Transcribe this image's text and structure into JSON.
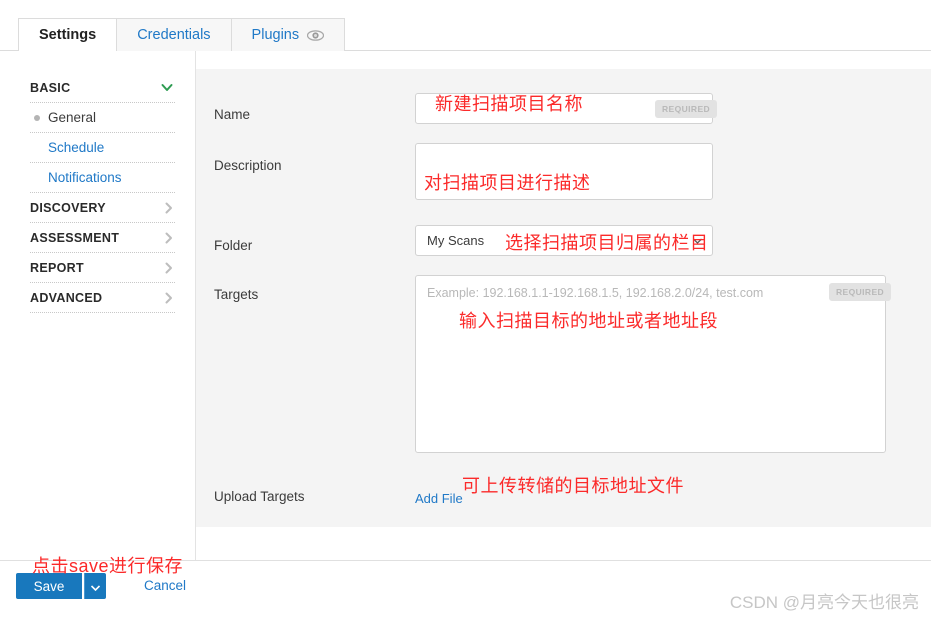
{
  "tabs": [
    {
      "label": "Settings",
      "active": true,
      "icon": null
    },
    {
      "label": "Credentials",
      "active": false,
      "icon": null
    },
    {
      "label": "Plugins",
      "active": false,
      "icon": "eye-icon"
    }
  ],
  "sidebar": {
    "groups": [
      {
        "label": "BASIC",
        "expanded": true,
        "icon": "chevron-down-icon",
        "items": [
          {
            "label": "General",
            "active": true
          },
          {
            "label": "Schedule",
            "active": false
          },
          {
            "label": "Notifications",
            "active": false
          }
        ]
      },
      {
        "label": "DISCOVERY",
        "expanded": false,
        "icon": "chevron-right-icon",
        "items": []
      },
      {
        "label": "ASSESSMENT",
        "expanded": false,
        "icon": "chevron-right-icon",
        "items": []
      },
      {
        "label": "REPORT",
        "expanded": false,
        "icon": "chevron-right-icon",
        "items": []
      },
      {
        "label": "ADVANCED",
        "expanded": false,
        "icon": "chevron-right-icon",
        "items": []
      }
    ]
  },
  "form": {
    "name": {
      "label": "Name",
      "value": "",
      "placeholder": "",
      "required_badge": "REQUIRED"
    },
    "description": {
      "label": "Description",
      "value": "",
      "placeholder": ""
    },
    "folder": {
      "label": "Folder",
      "value": "My Scans",
      "options": [
        "My Scans"
      ]
    },
    "targets": {
      "label": "Targets",
      "value": "",
      "placeholder": "Example: 192.168.1.1-192.168.1.5, 192.168.2.0/24, test.com",
      "required_badge": "REQUIRED"
    },
    "upload_targets": {
      "label": "Upload Targets",
      "add_file_label": "Add File"
    }
  },
  "annotations": [
    {
      "id": "name-annot",
      "text": "新建扫描项目名称"
    },
    {
      "id": "description-annot",
      "text": "对扫描项目进行描述"
    },
    {
      "id": "folder-annot",
      "text": "选择扫描项目归属的栏目"
    },
    {
      "id": "targets-annot",
      "text": "输入扫描目标的地址或者地址段"
    },
    {
      "id": "upload-annot",
      "text": "可上传转储的目标地址文件"
    },
    {
      "id": "save-annot",
      "text": "点击save进行保存"
    }
  ],
  "footer": {
    "save_label": "Save",
    "cancel_label": "Cancel"
  },
  "watermark": "CSDN @月亮今天也很亮",
  "colors": {
    "accent_blue": "#1878bd",
    "link_blue": "#2079c7",
    "annotation_red": "#fb2a2a",
    "panel_gray": "#f4f4f4",
    "badge_gray": "#e2e2e2"
  }
}
